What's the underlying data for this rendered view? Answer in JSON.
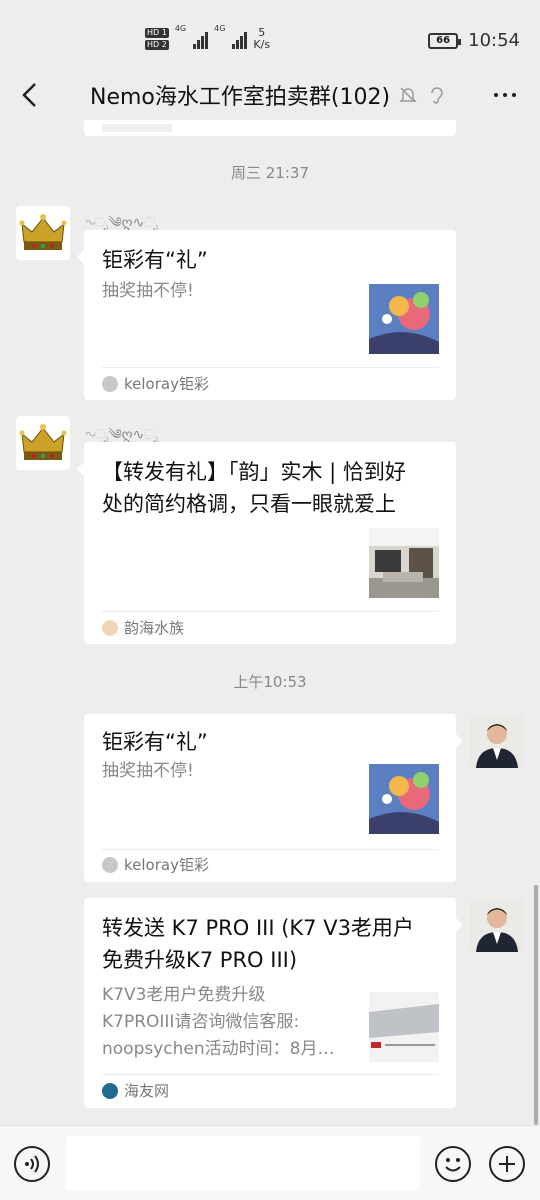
{
  "status_bar": {
    "network_1": "4G",
    "network_2": "4G",
    "speed_value": "5",
    "speed_unit": "K/s",
    "battery": "66",
    "time": "10:54"
  },
  "header": {
    "title": "Nemo海水工作室拍卖群(102)"
  },
  "timestamps": {
    "t1": "周三 21:37",
    "t2": "上午10:53"
  },
  "messages": [
    {
      "title": "钜彩有“礼”",
      "desc": "抽奖抽不停!",
      "source": "keloray钜彩"
    },
    {
      "title_line1": "【转发有礼】「韵」实木 | 恰到好",
      "title_line2": "处的简约格调，只看一眼就爱上",
      "source": "韵海水族"
    },
    {
      "title": "钜彩有“礼”",
      "desc": "抽奖抽不停!",
      "source": "keloray钜彩"
    },
    {
      "title_line1": "转发送 K7 PRO III (K7 V3老用户",
      "title_line2": "免费升级K7 PRO III)",
      "desc_line1": "K7V3老用户免费升级",
      "desc_line2": "K7PROIII请咨询微信客服:",
      "desc_line3": "noopsychen活动时间：8月…",
      "source": "海友网"
    }
  ]
}
